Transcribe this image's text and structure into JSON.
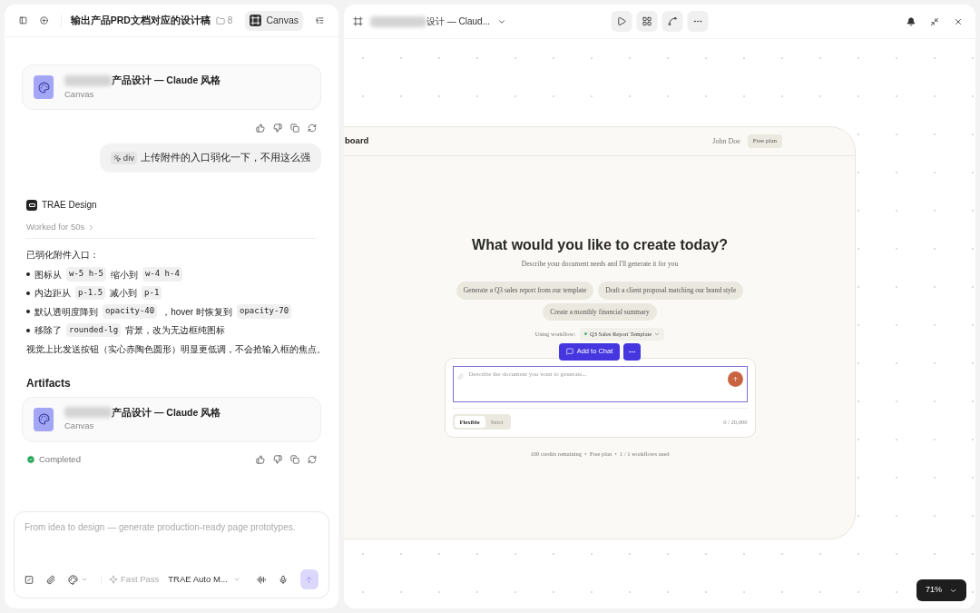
{
  "chat_panel": {
    "header": {
      "title": "输出产品PRD文档对应的设计稿",
      "folder_count": "8",
      "canvas_tab": {
        "label": "Canvas",
        "selected": true
      }
    },
    "artifact_card": {
      "title": "产品设计 — Claude 风格",
      "subtitle": "Canvas"
    },
    "user_message": {
      "chip": "div",
      "text": "上传附件的入口弱化一下，不用这么强"
    },
    "assistant": {
      "name": "TRAE Design",
      "worked": "Worked for 50s",
      "intro": "已弱化附件入口：",
      "bullets": [
        [
          {
            "kind": "text",
            "text": "图标从"
          },
          {
            "kind": "code",
            "text": "w-5 h-5"
          },
          {
            "kind": "text",
            "text": "缩小到"
          },
          {
            "kind": "code",
            "text": "w-4 h-4"
          }
        ],
        [
          {
            "kind": "text",
            "text": "内边距从"
          },
          {
            "kind": "code",
            "text": "p-1.5"
          },
          {
            "kind": "text",
            "text": "减小到"
          },
          {
            "kind": "code",
            "text": "p-1"
          }
        ],
        [
          {
            "kind": "text",
            "text": "默认透明度降到"
          },
          {
            "kind": "code",
            "text": "opacity-40"
          },
          {
            "kind": "text",
            "text": "，hover 时恢复到"
          },
          {
            "kind": "code",
            "text": "opacity-70"
          }
        ],
        [
          {
            "kind": "text",
            "text": "移除了"
          },
          {
            "kind": "code",
            "text": "rounded-lg"
          },
          {
            "kind": "text",
            "text": "背景，改为无边框纯图标"
          }
        ]
      ],
      "conclusion": "视觉上比发送按钮（实心赤陶色圆形）明显更低调，不会抢输入框的焦点。"
    },
    "artifacts": {
      "heading": "Artifacts",
      "card": {
        "title": "产品设计 — Claude 风格",
        "subtitle": "Canvas"
      },
      "status": "Completed"
    },
    "composer": {
      "placeholder": "From idea to design — generate production-ready page prototypes.",
      "fast_pass": {
        "label": "Fast Pass",
        "disabled": true
      },
      "model": "TRAE Auto M..."
    }
  },
  "canvas_panel": {
    "header": {
      "title": "设计 — Claud..."
    },
    "artboard": {
      "brand": "board",
      "user": "John Doe",
      "plan": "Free plan",
      "heading": "What would you like to create today?",
      "subheading": "Describe your document needs and I'll generate it for you",
      "suggestions": [
        "Generate a Q3 sales report from our template",
        "Draft a client proposal matching our brand style",
        "Create a monthly financial summary"
      ],
      "workflow_label": "Using workflow:",
      "workflow": "Q3 Sales Report Template",
      "popup": "Add to Chat",
      "input_placeholder": "Describe the document you want to generate...",
      "modes": [
        {
          "label": "Flexible",
          "selected": true
        },
        {
          "label": "Strict",
          "selected": false
        }
      ],
      "counter": "0 / 20,000",
      "footer": "100 credits remaining  •  Free plan  •  1 / 1 workflows used"
    },
    "zoom": "71%"
  }
}
